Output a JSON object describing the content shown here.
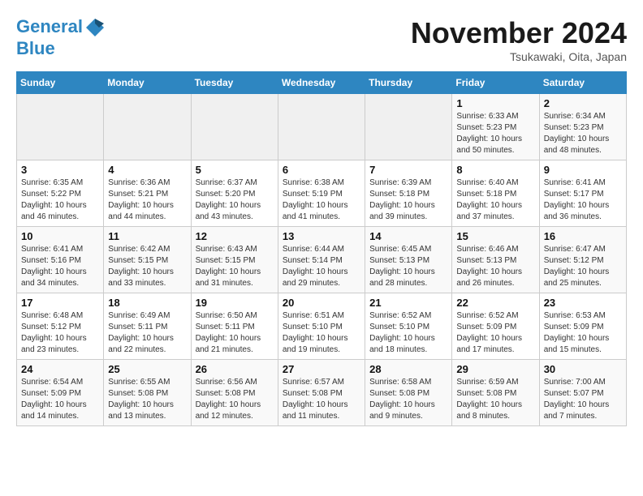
{
  "header": {
    "logo_line1": "General",
    "logo_line2": "Blue",
    "month": "November 2024",
    "location": "Tsukawaki, Oita, Japan"
  },
  "days_of_week": [
    "Sunday",
    "Monday",
    "Tuesday",
    "Wednesday",
    "Thursday",
    "Friday",
    "Saturday"
  ],
  "weeks": [
    [
      {
        "day": "",
        "info": ""
      },
      {
        "day": "",
        "info": ""
      },
      {
        "day": "",
        "info": ""
      },
      {
        "day": "",
        "info": ""
      },
      {
        "day": "",
        "info": ""
      },
      {
        "day": "1",
        "info": "Sunrise: 6:33 AM\nSunset: 5:23 PM\nDaylight: 10 hours and 50 minutes."
      },
      {
        "day": "2",
        "info": "Sunrise: 6:34 AM\nSunset: 5:23 PM\nDaylight: 10 hours and 48 minutes."
      }
    ],
    [
      {
        "day": "3",
        "info": "Sunrise: 6:35 AM\nSunset: 5:22 PM\nDaylight: 10 hours and 46 minutes."
      },
      {
        "day": "4",
        "info": "Sunrise: 6:36 AM\nSunset: 5:21 PM\nDaylight: 10 hours and 44 minutes."
      },
      {
        "day": "5",
        "info": "Sunrise: 6:37 AM\nSunset: 5:20 PM\nDaylight: 10 hours and 43 minutes."
      },
      {
        "day": "6",
        "info": "Sunrise: 6:38 AM\nSunset: 5:19 PM\nDaylight: 10 hours and 41 minutes."
      },
      {
        "day": "7",
        "info": "Sunrise: 6:39 AM\nSunset: 5:18 PM\nDaylight: 10 hours and 39 minutes."
      },
      {
        "day": "8",
        "info": "Sunrise: 6:40 AM\nSunset: 5:18 PM\nDaylight: 10 hours and 37 minutes."
      },
      {
        "day": "9",
        "info": "Sunrise: 6:41 AM\nSunset: 5:17 PM\nDaylight: 10 hours and 36 minutes."
      }
    ],
    [
      {
        "day": "10",
        "info": "Sunrise: 6:41 AM\nSunset: 5:16 PM\nDaylight: 10 hours and 34 minutes."
      },
      {
        "day": "11",
        "info": "Sunrise: 6:42 AM\nSunset: 5:15 PM\nDaylight: 10 hours and 33 minutes."
      },
      {
        "day": "12",
        "info": "Sunrise: 6:43 AM\nSunset: 5:15 PM\nDaylight: 10 hours and 31 minutes."
      },
      {
        "day": "13",
        "info": "Sunrise: 6:44 AM\nSunset: 5:14 PM\nDaylight: 10 hours and 29 minutes."
      },
      {
        "day": "14",
        "info": "Sunrise: 6:45 AM\nSunset: 5:13 PM\nDaylight: 10 hours and 28 minutes."
      },
      {
        "day": "15",
        "info": "Sunrise: 6:46 AM\nSunset: 5:13 PM\nDaylight: 10 hours and 26 minutes."
      },
      {
        "day": "16",
        "info": "Sunrise: 6:47 AM\nSunset: 5:12 PM\nDaylight: 10 hours and 25 minutes."
      }
    ],
    [
      {
        "day": "17",
        "info": "Sunrise: 6:48 AM\nSunset: 5:12 PM\nDaylight: 10 hours and 23 minutes."
      },
      {
        "day": "18",
        "info": "Sunrise: 6:49 AM\nSunset: 5:11 PM\nDaylight: 10 hours and 22 minutes."
      },
      {
        "day": "19",
        "info": "Sunrise: 6:50 AM\nSunset: 5:11 PM\nDaylight: 10 hours and 21 minutes."
      },
      {
        "day": "20",
        "info": "Sunrise: 6:51 AM\nSunset: 5:10 PM\nDaylight: 10 hours and 19 minutes."
      },
      {
        "day": "21",
        "info": "Sunrise: 6:52 AM\nSunset: 5:10 PM\nDaylight: 10 hours and 18 minutes."
      },
      {
        "day": "22",
        "info": "Sunrise: 6:52 AM\nSunset: 5:09 PM\nDaylight: 10 hours and 17 minutes."
      },
      {
        "day": "23",
        "info": "Sunrise: 6:53 AM\nSunset: 5:09 PM\nDaylight: 10 hours and 15 minutes."
      }
    ],
    [
      {
        "day": "24",
        "info": "Sunrise: 6:54 AM\nSunset: 5:09 PM\nDaylight: 10 hours and 14 minutes."
      },
      {
        "day": "25",
        "info": "Sunrise: 6:55 AM\nSunset: 5:08 PM\nDaylight: 10 hours and 13 minutes."
      },
      {
        "day": "26",
        "info": "Sunrise: 6:56 AM\nSunset: 5:08 PM\nDaylight: 10 hours and 12 minutes."
      },
      {
        "day": "27",
        "info": "Sunrise: 6:57 AM\nSunset: 5:08 PM\nDaylight: 10 hours and 11 minutes."
      },
      {
        "day": "28",
        "info": "Sunrise: 6:58 AM\nSunset: 5:08 PM\nDaylight: 10 hours and 9 minutes."
      },
      {
        "day": "29",
        "info": "Sunrise: 6:59 AM\nSunset: 5:08 PM\nDaylight: 10 hours and 8 minutes."
      },
      {
        "day": "30",
        "info": "Sunrise: 7:00 AM\nSunset: 5:07 PM\nDaylight: 10 hours and 7 minutes."
      }
    ]
  ]
}
